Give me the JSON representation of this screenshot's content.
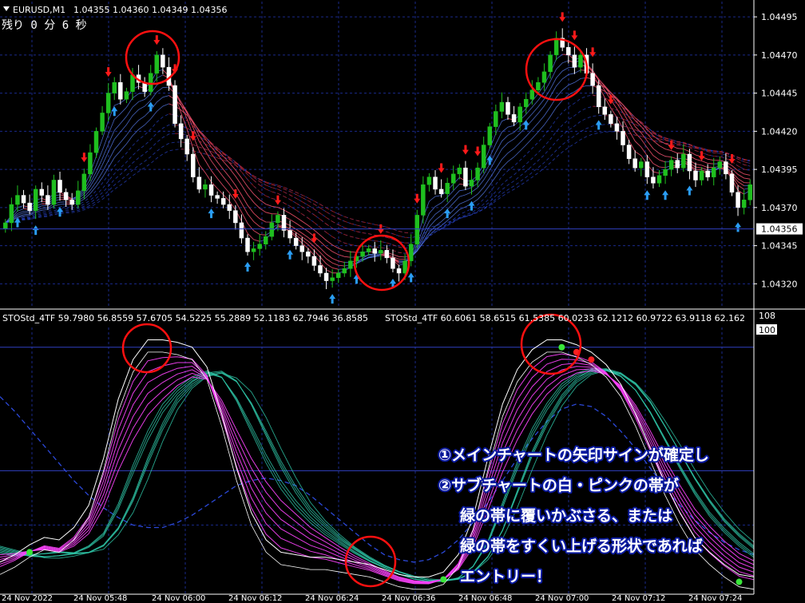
{
  "header": {
    "symbol_label": "EURUSD,M1",
    "ohlc": "1.04355 1.04360 1.04349 1.04356",
    "menu_icon": "triangle-down-icon"
  },
  "countdown": "残り 0 分 6 秒",
  "price_axis": {
    "ticks": [
      "1.04495",
      "1.04470",
      "1.04445",
      "1.04420",
      "1.04395",
      "1.04370",
      "1.04345",
      "1.04320"
    ],
    "current_price": "1.04356",
    "current_price_value": 1.04356
  },
  "indicator_header": {
    "left": "STOStd_4TF 59.7980 56.8559 57.6705 54.5225 55.2889 52.1183 62.7946 36.8585",
    "right": "STOStd_4TF 60.6061 58.6515 61.5385 60.0233 62.1212 60.9722 63.9118 62.162"
  },
  "indicator_axis": {
    "top": "108",
    "level": "100"
  },
  "time_axis": [
    "24 Nov 2022",
    "24 Nov 05:48",
    "24 Nov 06:00",
    "24 Nov 06:12",
    "24 Nov 06:24",
    "24 Nov 06:36",
    "24 Nov 06:48",
    "24 Nov 07:00",
    "24 Nov 07:12",
    "24 Nov 07:24"
  ],
  "annotations": [
    "①メインチャートの矢印サインが確定し",
    "②サブチャートの白・ピンクの帯が",
    "緑の帯に覆いかぶさる、または",
    "緑の帯をすくい上げる形状であれば",
    "エントリー！"
  ],
  "colors": {
    "bull": "#1fbf1f",
    "bear": "#ffffff",
    "sell_arrow": "#ff1a1a",
    "buy_arrow": "#2a9df4",
    "circle": "#ff1010",
    "grid": "#1a2a8a",
    "stoch_main": "#ff44ff",
    "stoch_fast": "#ffffff",
    "stoch_slow": "#2ec4a6"
  },
  "chart_data": [
    {
      "type": "candlestick",
      "title": "EURUSD,M1",
      "ylim": [
        1.04305,
        1.04505
      ],
      "close": [
        1.0436,
        1.04372,
        1.04378,
        1.04373,
        1.04368,
        1.04382,
        1.04378,
        1.04372,
        1.04388,
        1.0438,
        1.04375,
        1.04372,
        1.04381,
        1.04392,
        1.04406,
        1.0442,
        1.04432,
        1.04445,
        1.04452,
        1.04441,
        1.04446,
        1.04457,
        1.04452,
        1.04446,
        1.04458,
        1.0447,
        1.04462,
        1.0445,
        1.04425,
        1.04415,
        1.04405,
        1.0439,
        1.04382,
        1.04385,
        1.04378,
        1.04376,
        1.04372,
        1.04368,
        1.0436,
        1.0435,
        1.04341,
        1.04343,
        1.04346,
        1.04351,
        1.0436,
        1.04365,
        1.04355,
        1.0435,
        1.04345,
        1.04341,
        1.04338,
        1.04332,
        1.04327,
        1.04322,
        1.04324,
        1.04327,
        1.0433,
        1.04335,
        1.04338,
        1.04341,
        1.04343,
        1.0434,
        1.04342,
        1.04337,
        1.0433,
        1.04327,
        1.04335,
        1.04346,
        1.04365,
        1.04385,
        1.0439,
        1.04382,
        1.04379,
        1.04386,
        1.04392,
        1.04396,
        1.04384,
        1.04388,
        1.04396,
        1.04411,
        1.04423,
        1.04433,
        1.04439,
        1.04431,
        1.04426,
        1.04436,
        1.04441,
        1.04447,
        1.04452,
        1.04459,
        1.0447,
        1.04481,
        1.04475,
        1.0447,
        1.04462,
        1.0447,
        1.04458,
        1.0445,
        1.04436,
        1.04431,
        1.04425,
        1.0442,
        1.04411,
        1.04402,
        1.04396,
        1.044,
        1.0439,
        1.04386,
        1.04391,
        1.04395,
        1.04401,
        1.04396,
        1.04405,
        1.04394,
        1.04388,
        1.04394,
        1.0439,
        1.04396,
        1.044,
        1.04392,
        1.0438,
        1.0437,
        1.04375,
        1.04385
      ]
    },
    {
      "type": "line",
      "title": "STOStd_4TF",
      "ylim": [
        0,
        108
      ],
      "reference_line": 100,
      "series": [
        {
          "name": "",
          "values": [
            10,
            13,
            17,
            20,
            19,
            24,
            33,
            52,
            76,
            92,
            100,
            100,
            99,
            97,
            89,
            70,
            48,
            30,
            19,
            14,
            13,
            12,
            12,
            11,
            10,
            9,
            7,
            5,
            4,
            4,
            6,
            13,
            28,
            52,
            74,
            88,
            96,
            100,
            100,
            98,
            95,
            90,
            82,
            70,
            56,
            42,
            30,
            20,
            14,
            9,
            5,
            4
          ]
        },
        {
          "name": "",
          "values": [
            22,
            20,
            18,
            16,
            15,
            15,
            16,
            18,
            24,
            33,
            45,
            58,
            70,
            79,
            85,
            87,
            85,
            80,
            72,
            62,
            52,
            42,
            34,
            27,
            21,
            16,
            12,
            9,
            7,
            6,
            6,
            7,
            10,
            16,
            25,
            37,
            50,
            62,
            73,
            81,
            86,
            88,
            87,
            83,
            76,
            67,
            58,
            49,
            41,
            34,
            28,
            23
          ]
        },
        {
          "name": "",
          "values": [
            80,
            74,
            67,
            60,
            53,
            46,
            40,
            35,
            31,
            28,
            27,
            27,
            29,
            32,
            36,
            40,
            44,
            46,
            47,
            46,
            44,
            40,
            35,
            30,
            25,
            20,
            16,
            14,
            13,
            14,
            17,
            22,
            29,
            37,
            46,
            55,
            63,
            70,
            75,
            77,
            76,
            72,
            66,
            59,
            51,
            43,
            36,
            30,
            25,
            21,
            18,
            16
          ]
        }
      ]
    }
  ]
}
